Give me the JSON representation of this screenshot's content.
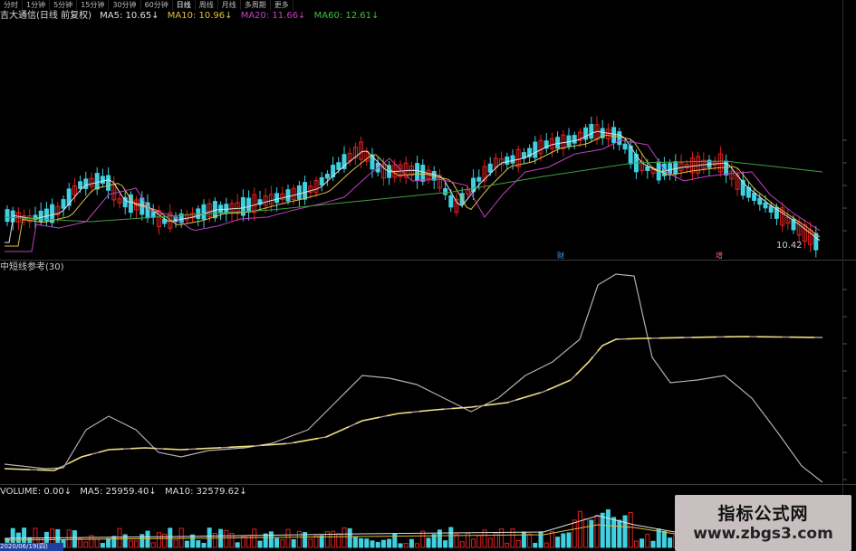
{
  "tabs": [
    "分时",
    "1分钟",
    "5分钟",
    "15分钟",
    "30分钟",
    "60分钟",
    "日线",
    "周线",
    "月线",
    "多周期",
    "更多"
  ],
  "main_legend": {
    "title": "吉大通信(日线 前复权)",
    "ma5": "MA5: 10.65↓",
    "ma10": "MA10: 10.96↓",
    "ma20": "MA20: 11.66↓",
    "ma60": "MA60: 12.61↓"
  },
  "indicator_legend": {
    "title": "中短线参考(30)"
  },
  "volume_legend": {
    "label": "VOLUME: 0.00↓",
    "ma5": "MA5: 25959.40↓",
    "ma10": "MA10: 32579.62↓"
  },
  "price_label": "10.42",
  "markers": {
    "m1": "财",
    "m2": "增"
  },
  "watermark": {
    "line1": "指标公式网",
    "line2": "www.zbgs3.com"
  },
  "date_label": "2020/06/19(四)",
  "colors": {
    "up": "#e02020",
    "down": "#40d0e0",
    "ma5": "#e0e0e0",
    "ma10": "#e0c040",
    "ma20": "#c040c0",
    "ma60": "#40a040"
  },
  "chart_data": [
    {
      "type": "line",
      "title": "吉大通信(日线 前复权)",
      "series": [
        {
          "name": "MA5",
          "values": [
            10.65
          ]
        },
        {
          "name": "MA10",
          "values": [
            10.96
          ]
        },
        {
          "name": "MA20",
          "values": [
            11.66
          ]
        },
        {
          "name": "MA60",
          "values": [
            12.61
          ]
        }
      ]
    },
    {
      "type": "bar",
      "title": "VOLUME",
      "series": [
        {
          "name": "MA5",
          "values": [
            25959.4
          ]
        },
        {
          "name": "MA10",
          "values": [
            32579.62
          ]
        }
      ]
    }
  ]
}
